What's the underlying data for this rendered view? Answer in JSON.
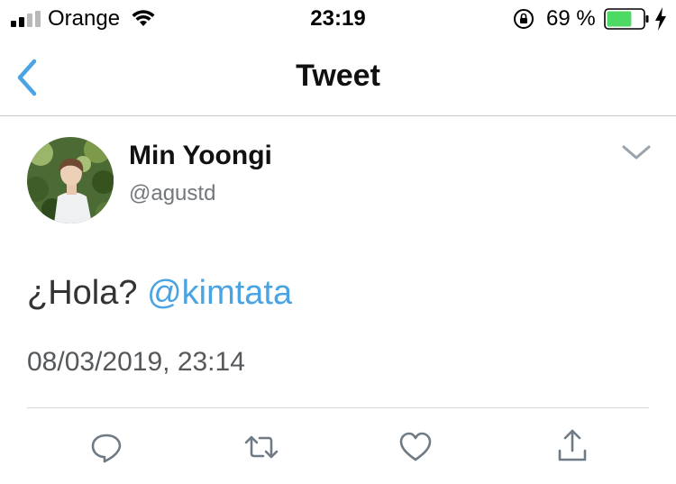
{
  "status_bar": {
    "carrier": "Orange",
    "time": "23:19",
    "battery_percent": "69 %",
    "battery_level": 0.69,
    "battery_color": "#4cd964",
    "icons": [
      "signal-icon",
      "wifi-icon",
      "orientation-lock-icon",
      "battery-icon",
      "charging-bolt-icon"
    ]
  },
  "nav": {
    "title": "Tweet",
    "back_icon": "chevron-left-icon",
    "accent_color": "#4aa3e2"
  },
  "tweet": {
    "display_name": "Min Yoongi",
    "handle": "@agustd",
    "text_plain": "¿Hola? ",
    "mention": "@kimtata",
    "timestamp": "08/03/2019, 23:14",
    "menu_icon": "chevron-down-icon"
  },
  "actions": [
    {
      "name": "reply",
      "icon": "reply-icon"
    },
    {
      "name": "retweet",
      "icon": "retweet-icon"
    },
    {
      "name": "like",
      "icon": "heart-icon"
    },
    {
      "name": "share",
      "icon": "share-icon"
    }
  ]
}
